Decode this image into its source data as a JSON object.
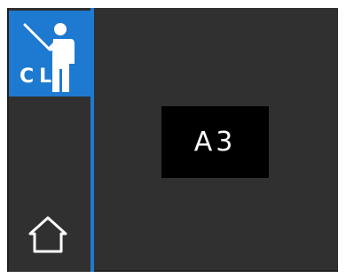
{
  "sidebar": {
    "mode_tile": {
      "label": "CL",
      "icon": "teacher-pointer-icon"
    },
    "home_button": {
      "icon": "home-icon"
    }
  },
  "display": {
    "value": "A3"
  },
  "colors": {
    "accent": "#1e7ad0",
    "panel": "#303030",
    "display_bg": "#000000",
    "text": "#ffffff"
  }
}
